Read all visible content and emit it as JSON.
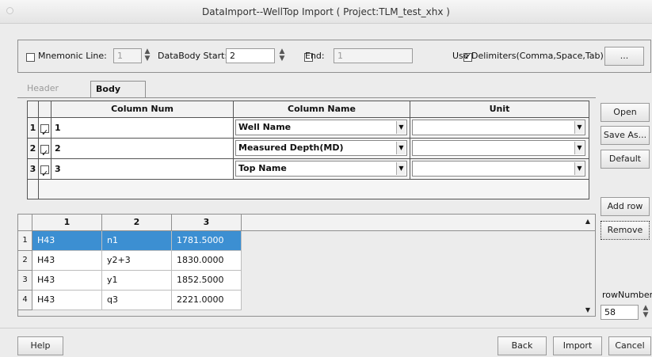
{
  "window": {
    "title": "DataImport--WellTop Import ( Project:TLM_test_xhx )"
  },
  "options": {
    "mnemonic_label": "Mnemonic Line:",
    "mnemonic_value": "1",
    "mnemonic_checked": false,
    "databody_label": "DataBody Start:",
    "databody_value": "2",
    "end_label": "End:",
    "end_value": "1",
    "end_checked": false,
    "delimiters_label": "Use Delimiters(Comma,Space,Tab)",
    "delimiters_checked": true,
    "browse_label": "..."
  },
  "tabs": [
    {
      "label": "Header Item",
      "active": false
    },
    {
      "label": "Body Item",
      "active": true
    }
  ],
  "mapping": {
    "headers": [
      "Column Num",
      "Column Name",
      "Unit"
    ],
    "rows": [
      {
        "index": "1",
        "checked": true,
        "column_num": "1",
        "column_name": "Well Name",
        "unit": ""
      },
      {
        "index": "2",
        "checked": true,
        "column_num": "2",
        "column_name": "Measured Depth(MD)",
        "unit": ""
      },
      {
        "index": "3",
        "checked": true,
        "column_num": "3",
        "column_name": "Top Name",
        "unit": ""
      }
    ]
  },
  "side_buttons": {
    "open": "Open",
    "save_as": "Save As...",
    "default": "Default",
    "add_row": "Add row",
    "remove": "Remove",
    "row_number_label": "rowNumber:",
    "row_number_value": "58"
  },
  "data_grid": {
    "headers": [
      "1",
      "2",
      "3"
    ],
    "rows": [
      {
        "n": "1",
        "c1": "H43",
        "c2": "n1",
        "c3": "1781.5000",
        "selected": true
      },
      {
        "n": "2",
        "c1": "H43",
        "c2": "y2+3",
        "c3": "1830.0000",
        "selected": false
      },
      {
        "n": "3",
        "c1": "H43",
        "c2": "y1",
        "c3": "1852.5000",
        "selected": false
      },
      {
        "n": "4",
        "c1": "H43",
        "c2": "q3",
        "c3": "2221.0000",
        "selected": false
      }
    ]
  },
  "footer": {
    "help": "Help",
    "back": "Back",
    "import": "Import",
    "cancel": "Cancel"
  }
}
